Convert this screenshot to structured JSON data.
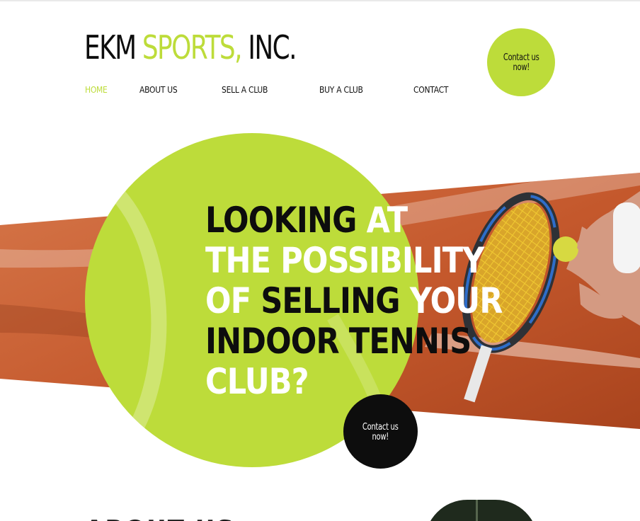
{
  "colors": {
    "accent": "#bddc3a",
    "dark": "#0d0d0d",
    "light_text": "#ffffff",
    "clay": "#c4582c",
    "clay_dark": "#a8431d",
    "clay_light": "#d6774a",
    "racket_frame": "#2e3136",
    "racket_blue": "#2e6dc9",
    "strings": "#f0c832",
    "skin": "#d49a82"
  },
  "logo": {
    "parts": [
      {
        "text": "EKM",
        "color": "#0d0d0d"
      },
      {
        "text": "SPORTS,",
        "color": "#bddc3a"
      },
      {
        "text": "INC.",
        "color": "#0d0d0d"
      }
    ]
  },
  "nav": {
    "items": [
      {
        "label": "HOME",
        "active": true
      },
      {
        "label": "ABOUT US",
        "active": false
      },
      {
        "label": "SELL A CLUB",
        "active": false
      },
      {
        "label": "BUY A CLUB",
        "active": false
      },
      {
        "label": "CONTACT",
        "active": false
      }
    ]
  },
  "header_cta": {
    "line1": "Contact us",
    "line2": "now!"
  },
  "hero": {
    "headline_lines": [
      [
        {
          "text": "LOOKING ",
          "tone": "dark"
        },
        {
          "text": "AT",
          "tone": "light"
        }
      ],
      [
        {
          "text": "THE POSSIBILITY",
          "tone": "light"
        }
      ],
      [
        {
          "text": "OF ",
          "tone": "light"
        },
        {
          "text": "SELLING ",
          "tone": "dark"
        },
        {
          "text": "YOUR",
          "tone": "light"
        }
      ],
      [
        {
          "text": "INDOOR TENNIS",
          "tone": "dark"
        }
      ],
      [
        {
          "text": "CLUB?",
          "tone": "light"
        }
      ]
    ],
    "cta": {
      "line1": "Contact us",
      "line2": "now!"
    }
  },
  "next_section": {
    "heading": "ABOUT US"
  }
}
